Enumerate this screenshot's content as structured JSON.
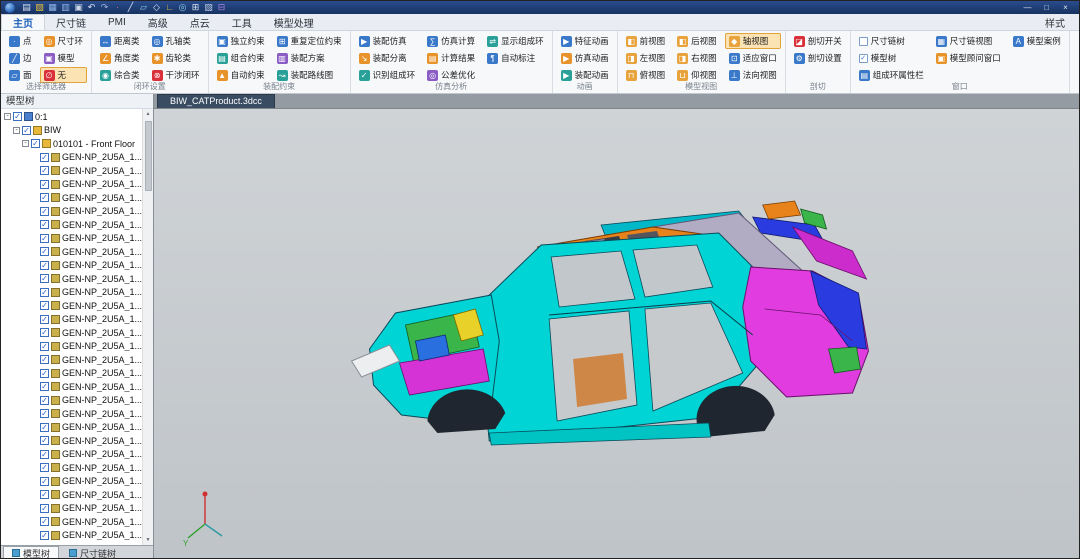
{
  "window": {
    "quick_icons": [
      {
        "name": "new-file-icon",
        "glyph": "▤",
        "color": "#d9e4f5"
      },
      {
        "name": "open-file-icon",
        "glyph": "▨",
        "color": "#e8c23a"
      },
      {
        "name": "save-icon",
        "glyph": "▦",
        "color": "#8fb8e8"
      },
      {
        "name": "save-all-icon",
        "glyph": "▥",
        "color": "#8fb8e8"
      },
      {
        "name": "print-icon",
        "glyph": "▣",
        "color": "#c8d4e8"
      },
      {
        "name": "undo-icon",
        "glyph": "↶",
        "color": "#d9e4f5"
      },
      {
        "name": "redo-icon",
        "glyph": "↷",
        "color": "#9fb4d8"
      },
      {
        "name": "point-tool-icon",
        "glyph": "∙",
        "color": "#e87070"
      },
      {
        "name": "line-tool-icon",
        "glyph": "╱",
        "color": "#d9e4f5"
      },
      {
        "name": "plane-tool-icon",
        "glyph": "▱",
        "color": "#8fd0e8"
      },
      {
        "name": "axis-tool-icon",
        "glyph": "◇",
        "color": "#d9e4f5"
      },
      {
        "name": "measure-tool-icon",
        "glyph": "∟",
        "color": "#e8c23a"
      },
      {
        "name": "view-tool-icon",
        "glyph": "◎",
        "color": "#8fd0e8"
      },
      {
        "name": "grid-tool-icon",
        "glyph": "⊞",
        "color": "#d9e4f5"
      },
      {
        "name": "display-tool-icon",
        "glyph": "▧",
        "color": "#b8c8e0"
      },
      {
        "name": "usb-device-icon",
        "glyph": "⊟",
        "color": "#a87fe0"
      }
    ],
    "controls": [
      {
        "id": "minimize",
        "glyph": "—"
      },
      {
        "id": "maximize",
        "glyph": "□"
      },
      {
        "id": "close",
        "glyph": "×"
      }
    ]
  },
  "ribbon": {
    "tabs": [
      {
        "id": "home",
        "label": "主页",
        "active": true
      },
      {
        "id": "dimension-chain",
        "label": "尺寸链"
      },
      {
        "id": "pmi",
        "label": "PMI"
      },
      {
        "id": "advanced",
        "label": "高级"
      },
      {
        "id": "point-cloud",
        "label": "点云"
      },
      {
        "id": "tools",
        "label": "工具"
      },
      {
        "id": "model-processing",
        "label": "模型处理"
      }
    ],
    "style_button": "样式",
    "groups": [
      {
        "id": "selection-filter",
        "name": "选择筛选器",
        "buttons": [
          {
            "id": "point-filter",
            "label": "点",
            "icon": "point-icon",
            "color": "#3a79c9",
            "glyph": "·"
          },
          {
            "id": "edge-filter",
            "label": "边",
            "icon": "edge-icon",
            "color": "#3a79c9",
            "glyph": "╱"
          },
          {
            "id": "face-filter",
            "label": "面",
            "icon": "face-icon",
            "color": "#3a79c9",
            "glyph": "▱"
          },
          {
            "id": "dimension-loop-filter",
            "label": "尺寸环",
            "icon": "dimension-loop-icon",
            "color": "#e8932a",
            "glyph": "◎"
          },
          {
            "id": "model-filter",
            "label": "模型",
            "icon": "model-icon",
            "color": "#8a5cc4",
            "glyph": "▣"
          },
          {
            "id": "no-filter",
            "label": "无",
            "icon": "none-icon",
            "color": "#d9303a",
            "glyph": "∅",
            "active": true
          }
        ]
      },
      {
        "id": "closed-loop-settings",
        "name": "闭环设置",
        "buttons": [
          {
            "id": "distance-loop",
            "label": "距离类",
            "icon": "distance-icon",
            "color": "#3a79c9",
            "glyph": "↔"
          },
          {
            "id": "angle-loop",
            "label": "角度类",
            "icon": "angle-icon",
            "color": "#e8932a",
            "glyph": "∠"
          },
          {
            "id": "composite-loop",
            "label": "综合类",
            "icon": "composite-icon",
            "color": "#2aa198",
            "glyph": "◉"
          },
          {
            "id": "hole-axis-loop",
            "label": "孔轴类",
            "icon": "hole-axis-icon",
            "color": "#3a79c9",
            "glyph": "◎"
          },
          {
            "id": "gear-loop",
            "label": "齿轮类",
            "icon": "gear-icon",
            "color": "#e8932a",
            "glyph": "✱"
          },
          {
            "id": "interference-loop",
            "label": "干涉闭环",
            "icon": "interference-icon",
            "color": "#d9303a",
            "glyph": "⊗"
          }
        ]
      },
      {
        "id": "assembly-constraints",
        "name": "装配约束",
        "buttons": [
          {
            "id": "independent-constraint",
            "label": "独立约束",
            "icon": "independent-constraint-icon",
            "color": "#3a79c9",
            "glyph": "▣"
          },
          {
            "id": "combined-constraint",
            "label": "组合约束",
            "icon": "combined-constraint-icon",
            "color": "#2aa198",
            "glyph": "▤"
          },
          {
            "id": "auto-constraint",
            "label": "自动约束",
            "icon": "auto-constraint-icon",
            "color": "#e8932a",
            "glyph": "▲"
          },
          {
            "id": "repeat-positioning-constraint",
            "label": "重复定位约束",
            "icon": "repeat-positioning-icon",
            "color": "#3a79c9",
            "glyph": "⊞"
          },
          {
            "id": "assembly-scheme",
            "label": "装配方案",
            "icon": "assembly-scheme-icon",
            "color": "#8a5cc4",
            "glyph": "▥"
          },
          {
            "id": "assembly-route-map",
            "label": "装配路线图",
            "icon": "assembly-route-icon",
            "color": "#2aa198",
            "glyph": "↝"
          }
        ]
      },
      {
        "id": "simulation-analysis",
        "name": "仿真分析",
        "buttons": [
          {
            "id": "assembly-simulation",
            "label": "装配仿真",
            "icon": "assembly-simulation-icon",
            "color": "#3a79c9",
            "glyph": "▶"
          },
          {
            "id": "assembly-separation",
            "label": "装配分离",
            "icon": "assembly-separation-icon",
            "color": "#e8932a",
            "glyph": "↘"
          },
          {
            "id": "identify-loops",
            "label": "识别组成环",
            "icon": "identify-loops-icon",
            "color": "#2aa198",
            "glyph": "✓"
          },
          {
            "id": "simulation-compute",
            "label": "仿真计算",
            "icon": "simulation-compute-icon",
            "color": "#3a79c9",
            "glyph": "∑"
          },
          {
            "id": "computation-result",
            "label": "计算结果",
            "icon": "computation-result-icon",
            "color": "#e8932a",
            "glyph": "▤"
          },
          {
            "id": "tolerance-optimization",
            "label": "公差优化",
            "icon": "tolerance-optimization-icon",
            "color": "#8a5cc4",
            "glyph": "◎"
          },
          {
            "id": "show-loops",
            "label": "显示组成环",
            "icon": "show-loops-icon",
            "color": "#2aa198",
            "glyph": "⇌"
          },
          {
            "id": "auto-annotation",
            "label": "自动标注",
            "icon": "auto-annotation-icon",
            "color": "#3a79c9",
            "glyph": "¶"
          }
        ]
      },
      {
        "id": "animation",
        "name": "动画",
        "buttons": [
          {
            "id": "feature-animation",
            "label": "特征动画",
            "icon": "feature-animation-icon",
            "color": "#3a79c9",
            "glyph": "▶"
          },
          {
            "id": "simulation-animation",
            "label": "仿真动画",
            "icon": "simulation-animation-icon",
            "color": "#e8932a",
            "glyph": "▶"
          },
          {
            "id": "assembly-animation",
            "label": "装配动画",
            "icon": "assembly-animation-icon",
            "color": "#2aa198",
            "glyph": "▶"
          }
        ]
      },
      {
        "id": "model-views",
        "name": "模型视图",
        "buttons": [
          {
            "id": "front-view",
            "label": "前视图",
            "icon": "front-view-icon",
            "color": "#e8a33d",
            "glyph": "◧"
          },
          {
            "id": "left-view",
            "label": "左视图",
            "icon": "left-view-icon",
            "color": "#e8a33d",
            "glyph": "◨"
          },
          {
            "id": "top-view",
            "label": "俯视图",
            "icon": "top-view-icon",
            "color": "#e8a33d",
            "glyph": "⊓"
          },
          {
            "id": "back-view",
            "label": "后视图",
            "icon": "back-view-icon",
            "color": "#e8a33d",
            "glyph": "◧"
          },
          {
            "id": "right-view",
            "label": "右视图",
            "icon": "right-view-icon",
            "color": "#e8a33d",
            "glyph": "◨"
          },
          {
            "id": "bottom-view",
            "label": "仰视图",
            "icon": "bottom-view-icon",
            "color": "#e8a33d",
            "glyph": "⊔"
          },
          {
            "id": "axonometric-view",
            "label": "轴视图",
            "icon": "axonometric-view-icon",
            "color": "#e8a33d",
            "glyph": "◆",
            "active": true
          },
          {
            "id": "fit-window",
            "label": "适应窗口",
            "icon": "fit-window-icon",
            "color": "#3a79c9",
            "glyph": "⊡"
          },
          {
            "id": "normal-view",
            "label": "法向视图",
            "icon": "normal-view-icon",
            "color": "#3a79c9",
            "glyph": "⊥"
          }
        ]
      },
      {
        "id": "section",
        "name": "剖切",
        "buttons": [
          {
            "id": "section-toggle",
            "label": "剖切开关",
            "icon": "section-toggle-icon",
            "color": "#d9303a",
            "glyph": "◪"
          },
          {
            "id": "section-settings",
            "label": "剖切设置",
            "icon": "section-settings-icon",
            "color": "#3a79c9",
            "glyph": "⚙"
          }
        ]
      },
      {
        "id": "window",
        "name": "窗口",
        "buttons": [
          {
            "id": "dimension-chain-tree-toggle",
            "label": "尺寸链树",
            "icon": "chain-tree-checkbox-icon",
            "check": false
          },
          {
            "id": "model-tree-toggle",
            "label": "模型树",
            "icon": "model-tree-checkbox-icon",
            "check": true
          },
          {
            "id": "loop-properties-bar",
            "label": "组成环属性栏",
            "icon": "loop-properties-icon",
            "color": "#3a79c9",
            "glyph": "▤"
          },
          {
            "id": "dimension-chain-view",
            "label": "尺寸链视图",
            "icon": "chain-view-icon",
            "color": "#3a79c9",
            "glyph": "▦"
          },
          {
            "id": "model-advisor-window",
            "label": "模型顾问窗口",
            "icon": "model-advisor-icon",
            "color": "#e8932a",
            "glyph": "▣"
          },
          {
            "spacer": true
          },
          {
            "id": "model-case",
            "label": "模型案例",
            "icon": "model-case-icon",
            "color": "#3a79c9",
            "glyph": "A"
          }
        ]
      }
    ]
  },
  "document_tab": {
    "label": "BIW_CATProduct.3dcc"
  },
  "model_tree": {
    "header": "模型树",
    "check_glyph": "✓",
    "expander_glyph": "-",
    "scrollbar": {
      "up": "▲",
      "down": "▼"
    },
    "nodes": [
      {
        "label": "0:1",
        "depth": 0,
        "type": "root",
        "expand": true
      },
      {
        "label": "BIW",
        "depth": 1,
        "type": "assembly",
        "expand": true
      },
      {
        "label": "010101 - Front Floor",
        "depth": 2,
        "type": "assembly",
        "expand": true
      }
    ],
    "parts": [
      "GEN-NP_2U5A_1...",
      "GEN-NP_2U5A_1...",
      "GEN-NP_2U5A_1...",
      "GEN-NP_2U5A_1...",
      "GEN-NP_2U5A_1...",
      "GEN-NP_2U5A_1...",
      "GEN-NP_2U5A_1...",
      "GEN-NP_2U5A_1...",
      "GEN-NP_2U5A_1...",
      "GEN-NP_2U5A_1...",
      "GEN-NP_2U5A_1...",
      "GEN-NP_2U5A_1...",
      "GEN-NP_2U5A_1...",
      "GEN-NP_2U5A_1...",
      "GEN-NP_2U5A_1...",
      "GEN-NP_2U5A_1...",
      "GEN-NP_2U5A_1...",
      "GEN-NP_2U5A_1...",
      "GEN-NP_2U5A_1...",
      "GEN-NP_2U5A_1...",
      "GEN-NP_2U5A_1...",
      "GEN-NP_2U5A_1...",
      "GEN-NP_2U5A_1...",
      "GEN-NP_2U5A_1...",
      "GEN-NP_2U5A_1...",
      "GEN-NP_2U5A_1...",
      "GEN-NP_2U5A_1...",
      "GEN-NP_2U5A_1...",
      "GEN-NP_2U5A_1..."
    ],
    "bottom_tabs": [
      {
        "id": "model-tree",
        "label": "模型树",
        "active": true
      },
      {
        "id": "dimension-chain-tree",
        "label": "尺寸链树",
        "active": false
      }
    ]
  },
  "viewport": {
    "axis_label": "Y"
  },
  "colors": {
    "titlebar": "#1d3e78",
    "accent": "#1a5fb8",
    "viewport_top": "#d0d4d7",
    "viewport_bottom": "#bfc4c8",
    "car_cyan": "#00d4d4",
    "car_magenta": "#e03ce0",
    "car_orange": "#e8821a",
    "car_roof_gray": "#b2abc4",
    "car_green": "#39b54a",
    "car_blue": "#2a3ce0",
    "car_yellow": "#e8d22a",
    "highlight": "#fbe3b3"
  }
}
